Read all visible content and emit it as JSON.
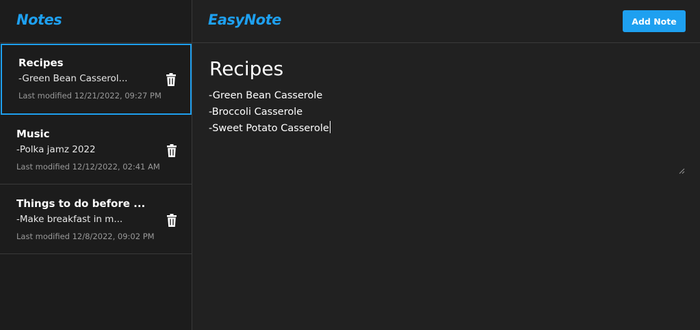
{
  "colors": {
    "accent": "#1ea0f0",
    "background": "#212121",
    "sidebar_background": "#1c1c1c",
    "text": "#ffffff",
    "muted_text": "#9a9a9a"
  },
  "sidebar": {
    "title": "Notes",
    "notes": [
      {
        "title": "Recipes",
        "preview": "-Green Bean Casserol...",
        "modified": "Last modified 12/21/2022, 09:27 PM",
        "selected": true,
        "delete_icon": "trash-icon"
      },
      {
        "title": "Music",
        "preview": "-Polka jamz 2022",
        "modified": "Last modified 12/12/2022, 02:41 AM",
        "selected": false,
        "delete_icon": "trash-icon"
      },
      {
        "title": "Things to do before ...",
        "preview": "-Make breakfast in m...",
        "modified": "Last modified 12/8/2022, 09:02 PM",
        "selected": false,
        "delete_icon": "trash-icon"
      }
    ]
  },
  "header": {
    "title": "EasyNote",
    "add_button_label": "Add Note"
  },
  "editor": {
    "title": "Recipes",
    "lines": [
      "-Green Bean Casserole",
      "-Broccoli Casserole",
      "-Sweet Potato Casserole"
    ]
  }
}
